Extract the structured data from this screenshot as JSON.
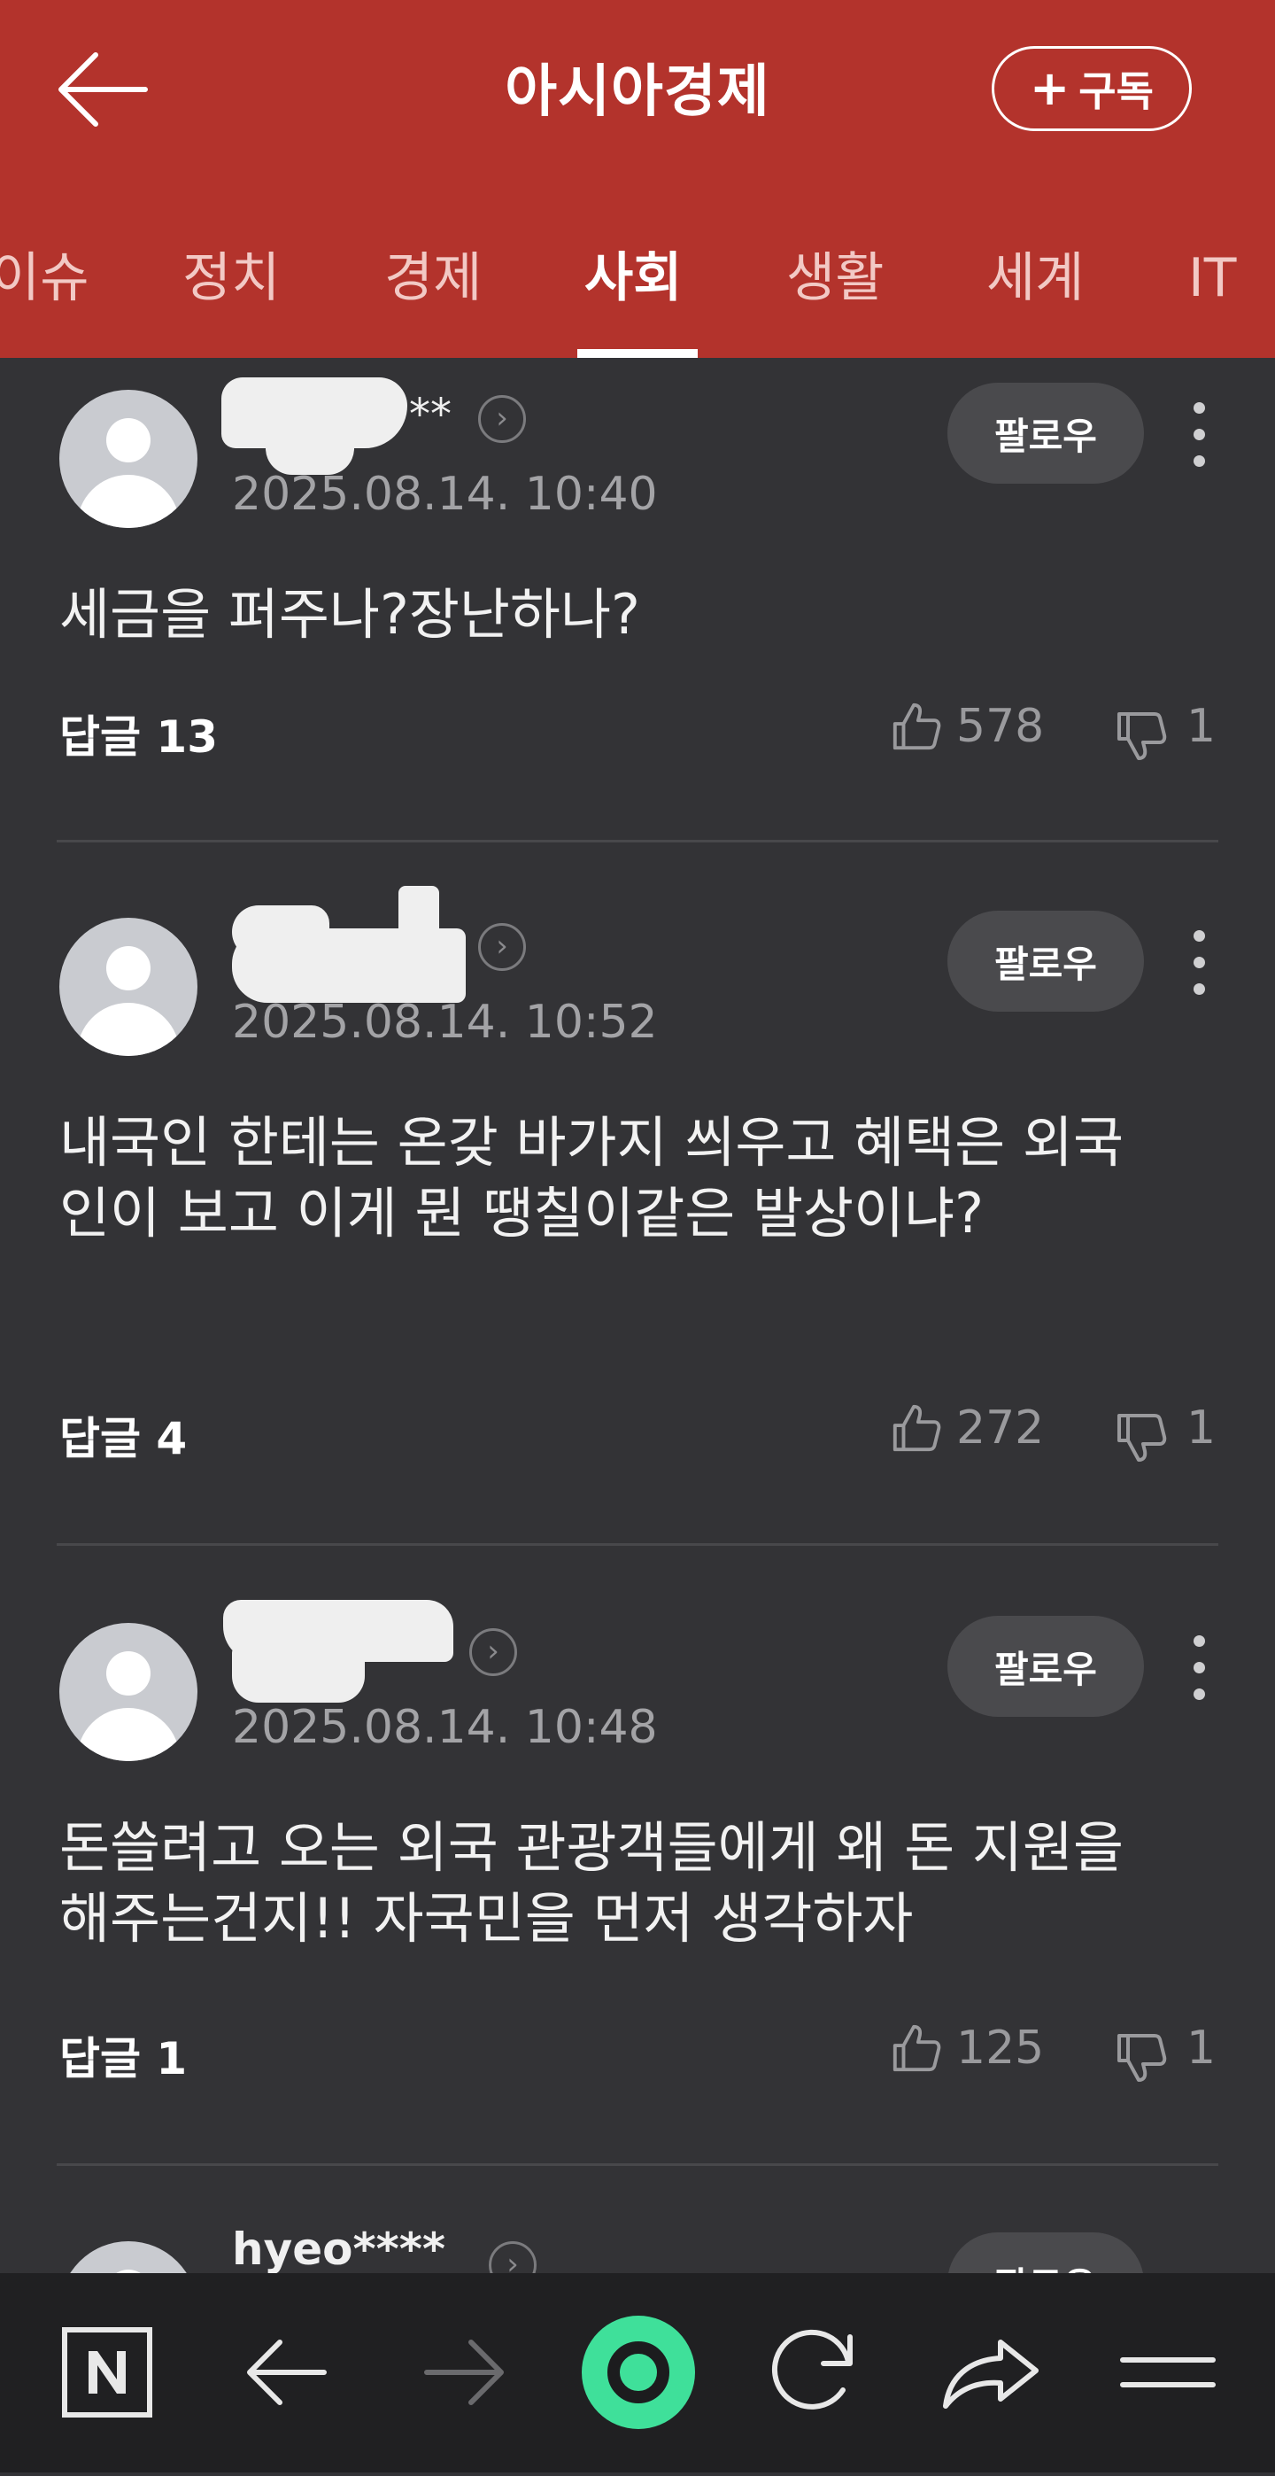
{
  "header": {
    "title": "아시아경제",
    "subscribe_label": "구독",
    "subscribe_plus": "+"
  },
  "tabs": [
    {
      "label": "이슈",
      "active": false
    },
    {
      "label": "정치",
      "active": false
    },
    {
      "label": "경제",
      "active": false
    },
    {
      "label": "사회",
      "active": true
    },
    {
      "label": "생활",
      "active": false
    },
    {
      "label": "세계",
      "active": false
    },
    {
      "label": "IT",
      "active": false
    }
  ],
  "comments": [
    {
      "username": "**",
      "timestamp": "2025.08.14. 10:40",
      "text": "세금을 퍼주나?장난하나?",
      "follow_label": "팔로우",
      "reply_label": "답글 13",
      "likes": "578",
      "dislikes": "1"
    },
    {
      "username": "",
      "timestamp": "2025.08.14. 10:52",
      "text": "내국인 한테는 온갖 바가지 씌우고 혜택은 외국인이 보고 이게 뭔 땡칠이같은 발상이냐?",
      "follow_label": "팔로우",
      "reply_label": "답글 4",
      "likes": "272",
      "dislikes": "1"
    },
    {
      "username": "",
      "timestamp": "2025.08.14. 10:48",
      "text": "돈쓸려고 오는 외국 관광객들에게 왜 돈 지원을 해주는건지!! 자국민을 먼저 생각하자",
      "follow_label": "팔로우",
      "reply_label": "답글 1",
      "likes": "125",
      "dislikes": "1"
    },
    {
      "username": "hyeo****",
      "follow_label": "팔로우"
    }
  ],
  "colors": {
    "brand_red": "#b3332c",
    "background": "#333336",
    "nav_bg": "#202022",
    "accent_green": "#3fe09a"
  },
  "icons": {
    "back": "arrow-left-icon",
    "profile_link": "chevron-right-circle-icon",
    "like": "thumbs-up-icon",
    "dislike": "thumbs-down-icon",
    "more": "vertical-ellipsis-icon",
    "nav": [
      "naver-n-icon",
      "back-arrow-icon",
      "forward-arrow-icon",
      "green-home-icon",
      "refresh-icon",
      "share-icon",
      "menu-icon"
    ]
  }
}
